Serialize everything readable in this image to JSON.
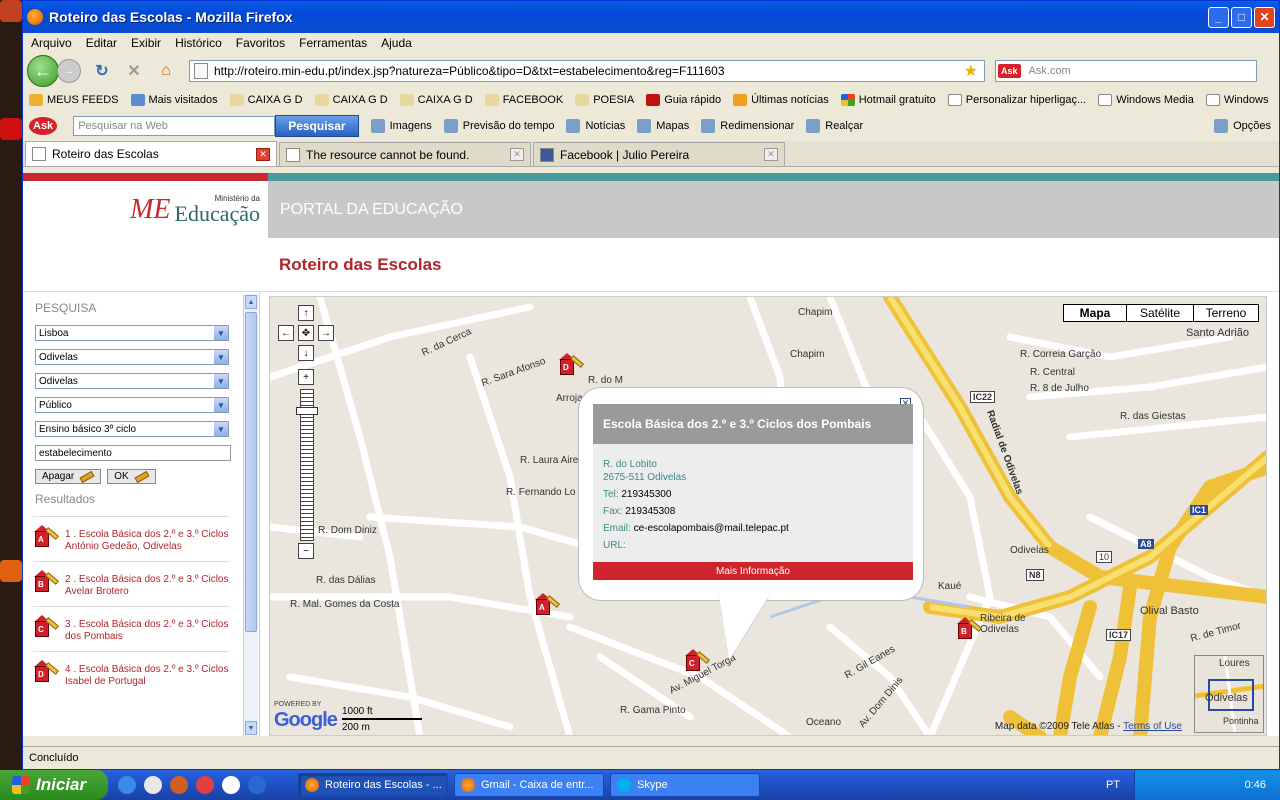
{
  "window": {
    "title": "Roteiro das Escolas - Mozilla Firefox"
  },
  "menu": [
    "Arquivo",
    "Editar",
    "Exibir",
    "Histórico",
    "Favoritos",
    "Ferramentas",
    "Ajuda"
  ],
  "nav": {
    "url": "http://roteiro.min-edu.pt/index.jsp?natureza=Público&tipo=D&txt=estabelecimento&reg=F111603",
    "search_placeholder": "Ask.com"
  },
  "bookmarks": [
    "MEUS FEEDS",
    "Mais visitados",
    "CAIXA G D",
    "CAIXA G D",
    "CAIXA G D",
    "FACEBOOK",
    "POESIA",
    "Guia rápido",
    "Últimas notícias",
    "Hotmail gratuito",
    "Personalizar hiperligaç...",
    "Windows Media",
    "Windows"
  ],
  "askbar": {
    "placeholder": "Pesquisar na Web",
    "button": "Pesquisar",
    "items": [
      "Imagens",
      "Previsão do tempo",
      "Notícias",
      "Mapas",
      "Redimensionar",
      "Realçar"
    ],
    "options": "Opções"
  },
  "tabs": [
    "Roteiro das Escolas",
    "The resource cannot be found.",
    "Facebook | Julio Pereira"
  ],
  "site": {
    "logo_small": "Ministério da",
    "logo_main": "Educação",
    "portal": "PORTAL DA EDUCAÇÃO",
    "page_title": "Roteiro das Escolas"
  },
  "sidebar": {
    "search_heading": "PESQUISA",
    "selects": [
      "Lisboa",
      "Odivelas",
      "Odivelas",
      "Público",
      "Ensino básico 3º ciclo"
    ],
    "text_value": "estabelecimento",
    "clear": "Apagar",
    "ok": "OK",
    "results_heading": "Resultados",
    "results": [
      {
        "letter": "A",
        "text": "1 . Escola Básica dos 2.º e 3.º Ciclos António Gedeão, Odivelas"
      },
      {
        "letter": "B",
        "text": "2 . Escola Básica dos 2.º e 3.º Ciclos Avelar Brotero"
      },
      {
        "letter": "C",
        "text": "3 . Escola Básica dos 2.º e 3.º Ciclos dos Pombais"
      },
      {
        "letter": "D",
        "text": "4 . Escola Básica dos 2.º e 3.º Ciclos Isabel de Portugal"
      }
    ]
  },
  "map": {
    "types": [
      "Mapa",
      "Satélite",
      "Terreno"
    ],
    "info": {
      "title": "Escola Básica dos 2.º e 3.º Ciclos dos Pombais",
      "addr1": "R. do Lobito",
      "addr2": "2675-511 Odivelas",
      "tel_label": "Tel:",
      "tel": "219345300",
      "fax_label": "Fax:",
      "fax": "219345308",
      "email_label": "Email:",
      "email": "ce-escolapombais@mail.telepac.pt",
      "url_label": "URL:",
      "more": "Mais Informação"
    },
    "labels": [
      "Chapim",
      "Chapim",
      "R. da Cerca",
      "R. Sara Afonso",
      "R. do M",
      "Arroja",
      "R. Laura Aires",
      "R. Fernando Lo",
      "R. Dom Diniz",
      "R. das Dálias",
      "R. Mal. Gomes da Costa",
      "R. Gama Pinto",
      "Av. Miguel Torga",
      "Oceano",
      "Av. Dom Dinis",
      "R. Gil Eanes",
      "Kaué",
      "Ribeira de Odivelas",
      "Olival Basto",
      "Santo Adrião",
      "R. Correia Garção",
      "R. Central",
      "R. 8 de Julho",
      "R. das Giestas",
      "Odivelas",
      "Radial de Odivelas",
      "IC22",
      "IC17",
      "IC1",
      "A8",
      "N8",
      "10",
      "R. de Timor",
      "Loures",
      "Odivelas",
      "Pontinha"
    ],
    "powered": "POWERED BY",
    "google": "Google",
    "scale_ft": "1000 ft",
    "scale_m": "200 m",
    "copyright": "Map data ©2009 Tele Atlas -",
    "terms": "Terms of Use"
  },
  "status": "Concluído",
  "taskbar": {
    "start": "Iniciar",
    "items": [
      "Roteiro das Escolas - ...",
      "Gmail - Caixa de entr...",
      "Skype"
    ],
    "lang": "PT",
    "time": "0:46"
  }
}
